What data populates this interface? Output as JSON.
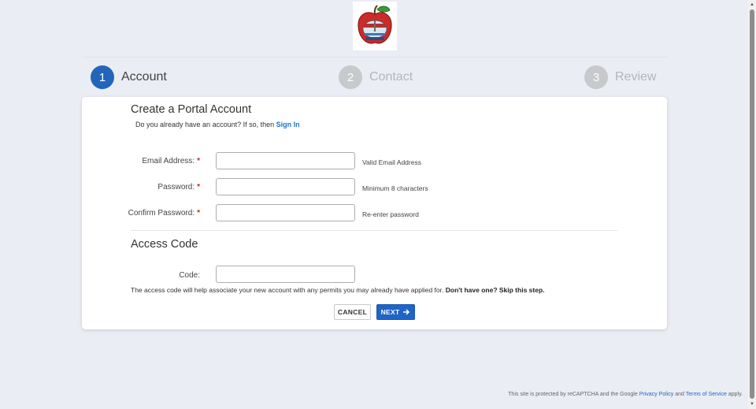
{
  "stepper": {
    "steps": [
      {
        "number": "1",
        "label": "Account",
        "state": "active"
      },
      {
        "number": "2",
        "label": "Contact",
        "state": "inactive"
      },
      {
        "number": "3",
        "label": "Review",
        "state": "inactive"
      }
    ]
  },
  "form": {
    "title": "Create a Portal Account",
    "question_text": "Do you already have an account? If so, then",
    "sign_in_link": "Sign In",
    "fields": [
      {
        "label": "Email Address:",
        "required": "*",
        "value": "",
        "hint": "Valid Email Address"
      },
      {
        "label": "Password:",
        "required": "*",
        "value": "",
        "hint": "Minimum 8 characters"
      },
      {
        "label": "Confirm Password:",
        "required": "*",
        "value": "",
        "hint": "Re-enter password"
      }
    ],
    "access_code": {
      "title": "Access Code",
      "label": "Code:",
      "value": "",
      "note_text": "The access code will help associate your new account with any permits you may already have applied for.",
      "note_bold": "Don't have one? Skip this step."
    },
    "buttons": {
      "cancel": "CANCEL",
      "next": "NEXT"
    }
  },
  "footer": {
    "prefix": "This site is protected by reCAPTCHA and the Google",
    "privacy_link": "Privacy Policy",
    "and": "and",
    "terms_link": "Terms of Service",
    "suffix": "apply."
  },
  "colors": {
    "accent": "#1f65c7",
    "step_active": "#2266bb",
    "step_inactive": "#c8c9cc",
    "required": "#cc2222",
    "background": "#eaedf3"
  }
}
